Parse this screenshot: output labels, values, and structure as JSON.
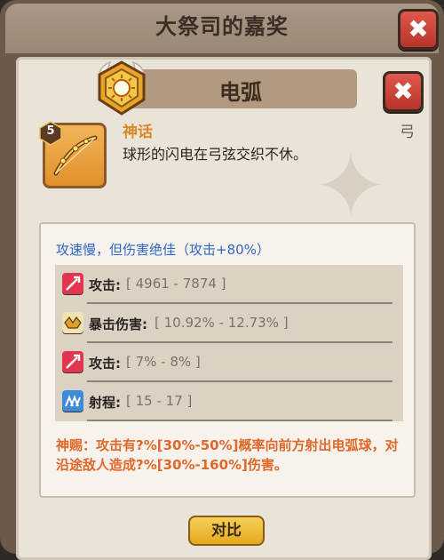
{
  "window": {
    "title": "大祭司的嘉奖",
    "close_icon": "close-x-icon"
  },
  "item": {
    "name": "电弧",
    "rarity": "神话",
    "type": "弓",
    "level": "5",
    "description": "球形的闪电在弓弦交织不休。",
    "icon": "bow-icon",
    "emblem_icon": "sun-emblem-icon"
  },
  "stats": {
    "passive": "攻速慢，但伤害绝佳（攻击+80%）",
    "rows": [
      {
        "label": "攻击:",
        "range": "[ 4961 - 7874 ]",
        "icon": "attack-icon",
        "icon_color": "#e2354f"
      },
      {
        "label": "暴击伤害:",
        "range": "[ 10.92% - 12.73% ]",
        "icon": "crit-icon",
        "icon_color": "#d9a02a"
      },
      {
        "label": "攻击:",
        "range": "[ 7% - 8% ]",
        "icon": "attack-icon",
        "icon_color": "#e2354f"
      },
      {
        "label": "射程:",
        "range": "[ 15 - 17 ]",
        "icon": "range-icon",
        "icon_color": "#3f8ad8"
      }
    ],
    "divine": "神赐：攻击有?%[30%-50%]概率向前方射出电弧球，对沿途敌人造成?%[30%-160%]伤害。"
  },
  "actions": {
    "compare_label": "对比"
  },
  "colors": {
    "accent": "#e5a820",
    "rarity": "#d98a28",
    "passive": "#2f66c4",
    "divine": "#e0682a"
  }
}
